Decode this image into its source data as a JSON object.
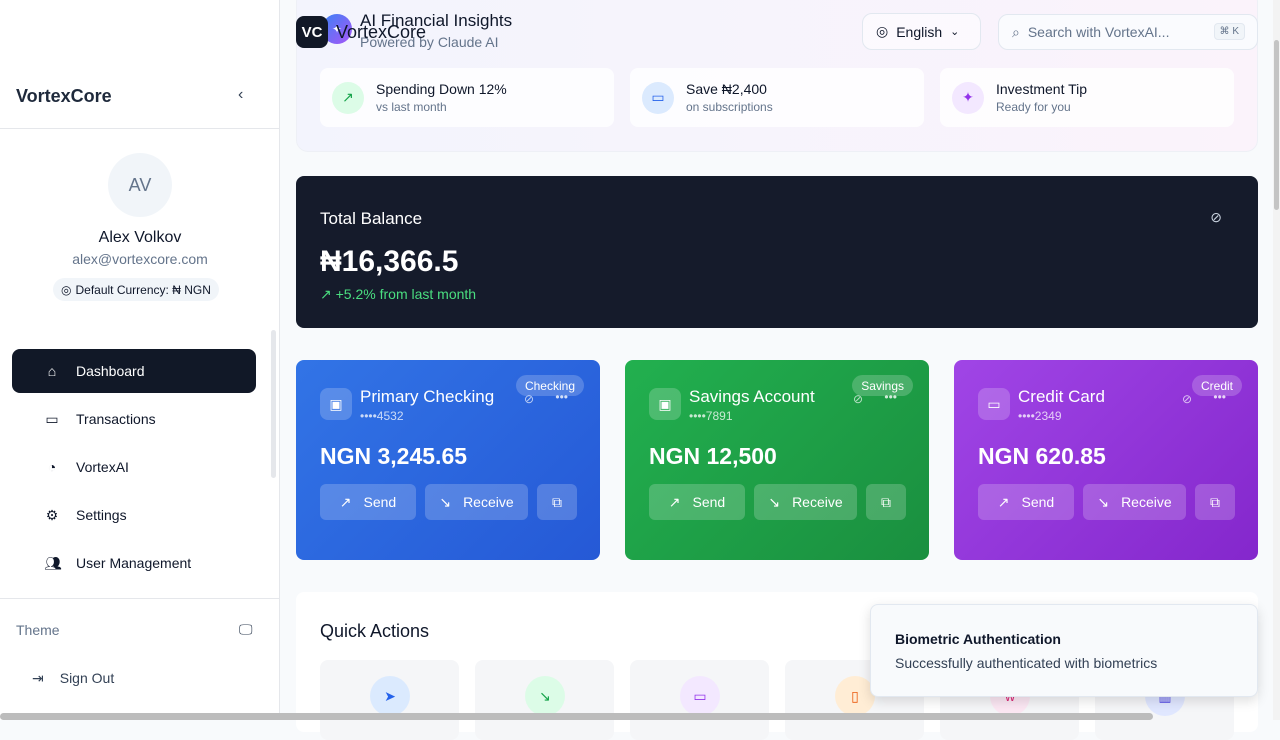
{
  "sidebar": {
    "brand": "VortexCore",
    "user": {
      "initials": "AV",
      "name": "Alex Volkov",
      "email": "alex@vortexcore.com",
      "currency": "Default Currency: ₦ NGN"
    },
    "items": [
      {
        "label": "Dashboard",
        "icon": "home-icon"
      },
      {
        "label": "Transactions",
        "icon": "credit-card-icon"
      },
      {
        "label": "VortexAI",
        "icon": "pie-chart-icon"
      },
      {
        "label": "Settings",
        "icon": "gear-icon"
      },
      {
        "label": "User Management",
        "icon": "users-icon"
      }
    ],
    "theme": "Theme",
    "sign_out": "Sign Out"
  },
  "header": {
    "logo": "VC",
    "logo_text": "VortexCore",
    "ai_title": "AI Financial Insights",
    "ai_sub": "Powered by Claude AI",
    "language": "English",
    "search_placeholder": "Search with VortexAI...",
    "shortcut": "⌘ K"
  },
  "insights": [
    {
      "title": "Spending Down 12%",
      "sub": "vs last month"
    },
    {
      "title": "Save ₦2,400",
      "sub": "on subscriptions"
    },
    {
      "title": "Investment Tip",
      "sub": "Ready for you"
    }
  ],
  "balance": {
    "label": "Total Balance",
    "amount": "₦16,366.5",
    "change": "+5.2% from last month"
  },
  "accounts": [
    {
      "name": "Primary Checking",
      "number": "••••4532",
      "type": "Checking",
      "balance": "NGN 3,245.65",
      "color": "#2f6be0"
    },
    {
      "name": "Savings Account",
      "number": "••••7891",
      "type": "Savings",
      "balance": "NGN 12,500",
      "color": "#1fa14b"
    },
    {
      "name": "Credit Card",
      "number": "••••2349",
      "type": "Credit",
      "balance": "NGN 620.85",
      "color": "#9438dc"
    }
  ],
  "account_actions": {
    "send": "Send",
    "receive": "Receive"
  },
  "quick_actions": {
    "title": "Quick Actions"
  },
  "toast": {
    "title": "Biometric Authentication",
    "message": "Successfully authenticated with biometrics"
  }
}
